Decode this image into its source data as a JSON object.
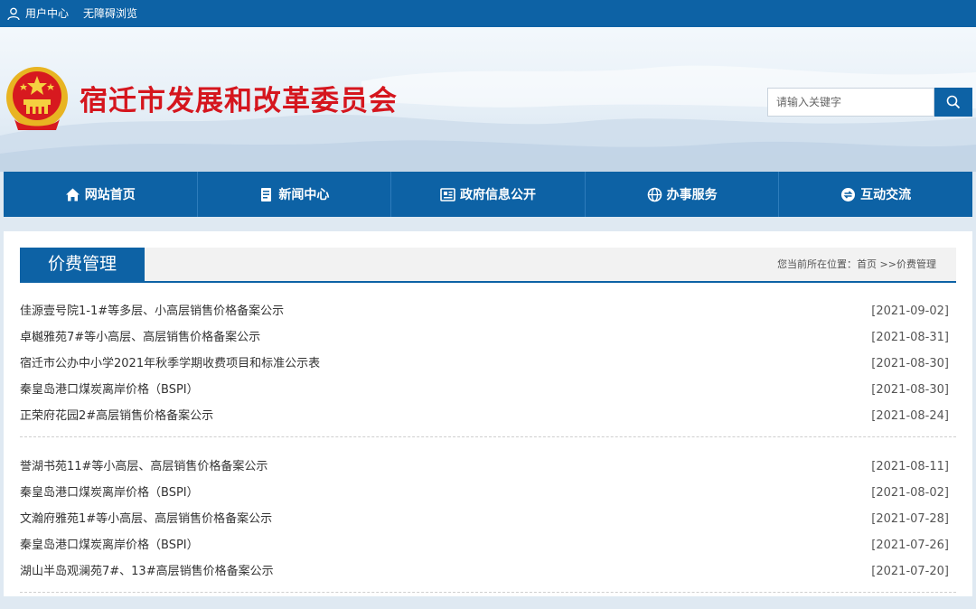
{
  "topbar": {
    "user_center": "用户中心",
    "accessibility": "无障碍浏览"
  },
  "header": {
    "site_title": "宿迁市发展和改革委员会",
    "search_placeholder": "请输入关键字"
  },
  "nav": {
    "items": [
      {
        "label": "网站首页",
        "icon": "home-icon"
      },
      {
        "label": "新闻中心",
        "icon": "news-icon"
      },
      {
        "label": "政府信息公开",
        "icon": "info-icon"
      },
      {
        "label": "办事服务",
        "icon": "globe-icon"
      },
      {
        "label": "互动交流",
        "icon": "exchange-icon"
      }
    ]
  },
  "section": {
    "title": "价费管理",
    "breadcrumb_prefix": "您当前所在位置：",
    "breadcrumb_home": "首页",
    "breadcrumb_sep": " >>",
    "breadcrumb_current": "价费管理"
  },
  "news": {
    "groups": [
      [
        {
          "title": "佳源壹号院1-1#等多层、小高层销售价格备案公示",
          "date": "[2021-09-02]"
        },
        {
          "title": "卓樾雅苑7#等小高层、高层销售价格备案公示",
          "date": "[2021-08-31]"
        },
        {
          "title": "宿迁市公办中小学2021年秋季学期收费项目和标准公示表",
          "date": "[2021-08-30]"
        },
        {
          "title": "秦皇岛港口煤炭离岸价格（BSPI）",
          "date": "[2021-08-30]"
        },
        {
          "title": "正荣府花园2#高层销售价格备案公示",
          "date": "[2021-08-24]"
        }
      ],
      [
        {
          "title": "誉湖书苑11#等小高层、高层销售价格备案公示",
          "date": "[2021-08-11]"
        },
        {
          "title": "秦皇岛港口煤炭离岸价格（BSPI）",
          "date": "[2021-08-02]"
        },
        {
          "title": "文瀚府雅苑1#等小高层、高层销售价格备案公示",
          "date": "[2021-07-28]"
        },
        {
          "title": "秦皇岛港口煤炭离岸价格（BSPI）",
          "date": "[2021-07-26]"
        },
        {
          "title": "湖山半岛观澜苑7#、13#高层销售价格备案公示",
          "date": "[2021-07-20]"
        }
      ]
    ]
  },
  "colors": {
    "primary": "#0d62a5",
    "title_red": "#d5161e"
  }
}
